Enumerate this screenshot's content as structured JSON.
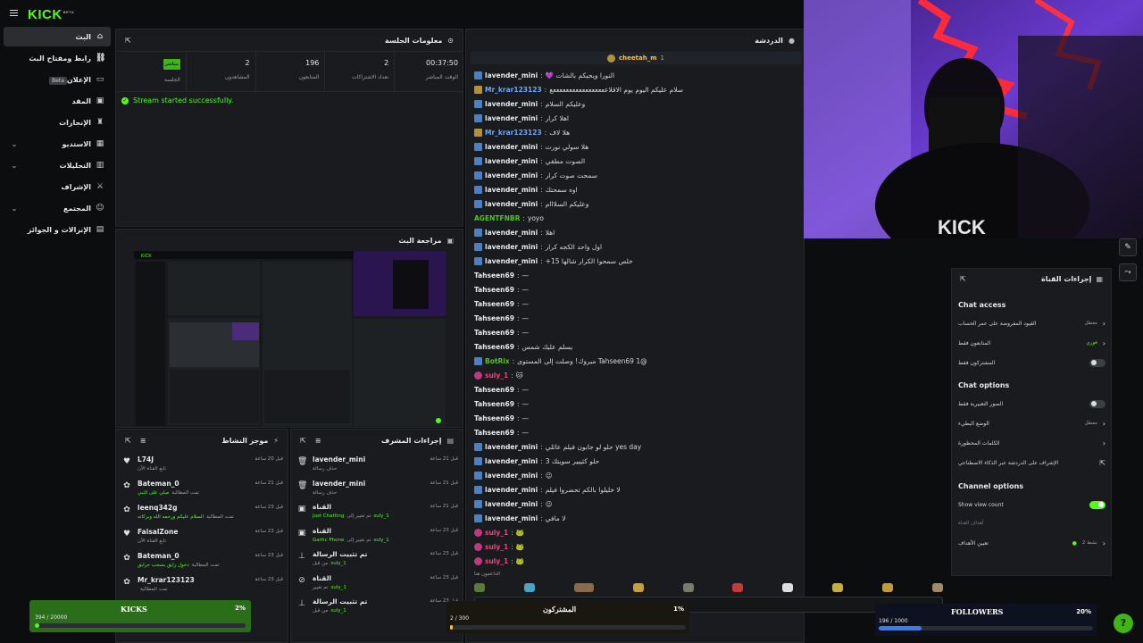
{
  "brand": {
    "logo": "KICK",
    "beta": "BETA"
  },
  "sidebar": {
    "items": [
      {
        "label": "البث",
        "icon": "home-icon",
        "active": true,
        "trail": ""
      },
      {
        "label": "رابط ومفتاح البث",
        "icon": "link-icon",
        "trail": ""
      },
      {
        "label": "الإعلان",
        "icon": "ad-icon",
        "badge": "Beta",
        "trail": ""
      },
      {
        "label": "المقد",
        "icon": "wallet-icon",
        "trail": ""
      },
      {
        "label": "الإنجازات",
        "icon": "trophy-icon",
        "trail": ""
      },
      {
        "label": "الاستديو",
        "icon": "studio-icon",
        "trail": "chevron"
      },
      {
        "label": "التحليلات",
        "icon": "analytics-icon",
        "trail": "chevron"
      },
      {
        "label": "الإشراف",
        "icon": "moderation-icon",
        "trail": ""
      },
      {
        "label": "المجتمع",
        "icon": "community-icon",
        "trail": "chevron"
      },
      {
        "label": "الإنزالات و الجوائز",
        "icon": "drops-icon",
        "trail": ""
      }
    ]
  },
  "session": {
    "title": "معلومات الجلسة",
    "live_label": "مباشر",
    "session_label": "الجلسة",
    "stats": [
      {
        "value": "2",
        "label": "المشاهدون"
      },
      {
        "value": "196",
        "label": "المتابعون"
      },
      {
        "value": "2",
        "label": "تعداد الاشتراكات"
      },
      {
        "value": "00:37:50",
        "label": "الوقت المباشر"
      }
    ],
    "message": "Stream started successfully."
  },
  "review": {
    "title": "مراجعة البث"
  },
  "chat": {
    "title": "الدردشة",
    "pinned_user": "cheetah_m",
    "pinned_count": "1",
    "messages": [
      {
        "user": "lavender_mini",
        "color": "#e6e8ea",
        "badge": "mod",
        "text": "النورا ويحيكم بالشات 💜"
      },
      {
        "user": "Mr_krar123123",
        "color": "#6aa7ff",
        "badge": "gold",
        "text": "سلام عليكم اليوم يوم الاقلاعععععععععععععععععع"
      },
      {
        "user": "lavender_mini",
        "color": "#e6e8ea",
        "badge": "mod",
        "text": "وعليكم السلام"
      },
      {
        "user": "lavender_mini",
        "color": "#e6e8ea",
        "badge": "mod",
        "text": "اهلا كرار"
      },
      {
        "user": "Mr_krar123123",
        "color": "#6aa7ff",
        "badge": "gold",
        "text": "هلا لاف"
      },
      {
        "user": "lavender_mini",
        "color": "#e6e8ea",
        "badge": "mod",
        "text": "هلا سولي نورت"
      },
      {
        "user": "lavender_mini",
        "color": "#e6e8ea",
        "badge": "mod",
        "text": "الصوت مطفي"
      },
      {
        "user": "lavender_mini",
        "color": "#e6e8ea",
        "badge": "mod",
        "text": "سمحت صوت كرار"
      },
      {
        "user": "lavender_mini",
        "color": "#e6e8ea",
        "badge": "mod",
        "text": "اوه سمحتك"
      },
      {
        "user": "lavender_mini",
        "color": "#e6e8ea",
        "badge": "mod",
        "text": "وعليكم السلااام"
      },
      {
        "user": "AGENTFNBR",
        "color": "#53c41a",
        "badge": "",
        "text": "yoyo"
      },
      {
        "user": "lavender_mini",
        "color": "#e6e8ea",
        "badge": "mod",
        "text": "اهلا"
      },
      {
        "user": "lavender_mini",
        "color": "#e6e8ea",
        "badge": "mod",
        "text": "اول واحد الكجه كرار"
      },
      {
        "user": "lavender_mini",
        "color": "#e6e8ea",
        "badge": "mod",
        "text": "خلص سمحوا الكرار شالها 15+"
      },
      {
        "user": "Tahseen69",
        "color": "#e6e8ea",
        "badge": "",
        "text": "—"
      },
      {
        "user": "Tahseen69",
        "color": "#e6e8ea",
        "badge": "",
        "text": "—"
      },
      {
        "user": "Tahseen69",
        "color": "#e6e8ea",
        "badge": "",
        "text": "—"
      },
      {
        "user": "Tahseen69",
        "color": "#e6e8ea",
        "badge": "",
        "text": "—"
      },
      {
        "user": "Tahseen69",
        "color": "#e6e8ea",
        "badge": "",
        "text": "—"
      },
      {
        "user": "Tahseen69",
        "color": "#e6e8ea",
        "badge": "",
        "text": "يسلم عليك شمس"
      },
      {
        "user": "BotRix",
        "color": "#53c41a",
        "badge": "mod",
        "text": "@Tahseen69 1 مبروك! وصلت إلى المستوى"
      },
      {
        "user": "suly_1",
        "color": "#e5487a",
        "badge": "pink",
        "text": "🐱"
      },
      {
        "user": "Tahseen69",
        "color": "#e6e8ea",
        "badge": "",
        "text": "—"
      },
      {
        "user": "Tahseen69",
        "color": "#e6e8ea",
        "badge": "",
        "text": "—"
      },
      {
        "user": "Tahseen69",
        "color": "#e6e8ea",
        "badge": "",
        "text": "—"
      },
      {
        "user": "Tahseen69",
        "color": "#e6e8ea",
        "badge": "",
        "text": "—"
      },
      {
        "user": "lavender_mini",
        "color": "#e6e8ea",
        "badge": "mod",
        "text": "yes day حلو لو جابون فيلم عائلي"
      },
      {
        "user": "lavender_mini",
        "color": "#e6e8ea",
        "badge": "mod",
        "text": "حلو كثييير سويتك 3"
      },
      {
        "user": "lavender_mini",
        "color": "#e6e8ea",
        "badge": "mod",
        "text": "😉"
      },
      {
        "user": "lavender_mini",
        "color": "#e6e8ea",
        "badge": "mod",
        "text": "لا خليلوا بالكم تحضروا فيلم"
      },
      {
        "user": "lavender_mini",
        "color": "#e6e8ea",
        "badge": "mod",
        "text": "😉"
      },
      {
        "user": "lavender_mini",
        "color": "#e6e8ea",
        "badge": "mod",
        "text": "لا مافي"
      },
      {
        "user": "suly_1",
        "color": "#e5487a",
        "badge": "pink",
        "text": "🐸"
      },
      {
        "user": "suly_1",
        "color": "#e5487a",
        "badge": "pink",
        "text": "🐸"
      },
      {
        "user": "suly_1",
        "color": "#e5487a",
        "badge": "pink",
        "text": "🐸"
      }
    ],
    "supporters_label": "الداعمون هنا"
  },
  "activity": {
    "title": "موجز النشاط",
    "items": [
      {
        "user": "L74J",
        "sub": "تابع القناة الآن",
        "time": "قبل 20 ساعة",
        "icon": "heart-icon"
      },
      {
        "user": "Bateman_0",
        "sub": "تمت المطالبة",
        "reward": "صلي على النبي",
        "time": "قبل 21 ساعة",
        "icon": "gift-icon"
      },
      {
        "user": "leenq342g",
        "sub": "تمت المطالبة",
        "reward": "السلام عليكم ورحمه الله وبركاته",
        "time": "قبل 23 ساعة",
        "icon": "gift-icon"
      },
      {
        "user": "FaisalZone",
        "sub": "تابع القناة الآن",
        "time": "قبل 23 ساعة",
        "icon": "heart-icon"
      },
      {
        "user": "Bateman_0",
        "sub": "تمت المطالبة",
        "reward": "دخول زايق بسحب حرايق",
        "time": "قبل 23 ساعة",
        "icon": "gift-icon"
      },
      {
        "user": "Mr_krar123123",
        "sub": "تمت المطالبة",
        "reward": "",
        "time": "قبل 23 ساعة",
        "icon": "gift-icon"
      }
    ]
  },
  "modactions": {
    "title": "إجراءات المشرف",
    "items": [
      {
        "user": "lavender_mini",
        "sub": "حذف رسالة",
        "time": "قبل 21 ساعة",
        "icon": "trash-icon"
      },
      {
        "user": "lavender_mini",
        "sub": "حذف رسالة",
        "time": "قبل 21 ساعة",
        "icon": "trash-icon"
      },
      {
        "user": "القناة",
        "sub": "تم تغيير إلى",
        "reward": "Just Chatting",
        "by": "suly_1",
        "time": "قبل 21 ساعة",
        "icon": "category-icon"
      },
      {
        "user": "القناة",
        "sub": "تم تغيير إلى",
        "reward": "Gartic Phone",
        "by": "suly_1",
        "time": "قبل 23 ساعة",
        "icon": "category-icon"
      },
      {
        "user": "تم تثبيت الرسالة",
        "sub": "من قبل",
        "by": "suly_1",
        "time": "قبل 23 ساعة",
        "icon": "pin-icon"
      },
      {
        "user": "القناة",
        "sub": "تم تغيير",
        "by": "suly_1",
        "time": "قبل 23 ساعة",
        "icon": "ban-icon"
      },
      {
        "user": "تم تثبيت الرسالة",
        "sub": "من قبل",
        "by": "suly_1",
        "time": "قبل 23 ساعة",
        "icon": "pin-icon"
      }
    ]
  },
  "channel_actions": {
    "title": "إجراءات القناة",
    "chat_access": "Chat access",
    "access_rows": [
      {
        "label": "القيود المفروضة على عمر الحساب",
        "value": "معطل",
        "type": "chev"
      },
      {
        "label": "المتابعون فقط",
        "value": "فوري",
        "type": "chev"
      },
      {
        "label": "المشتركون فقط",
        "value": "",
        "type": "toggle",
        "on": false
      }
    ],
    "chat_options": "Chat options",
    "option_rows": [
      {
        "label": "الصور التعبيرية فقط",
        "value": "",
        "type": "toggle",
        "on": false
      },
      {
        "label": "الوضع البطيء",
        "value": "معطل",
        "type": "chev"
      },
      {
        "label": "الكلمات المحظورة",
        "value": "",
        "type": "chev"
      },
      {
        "label": "الإشراف على الدردشة عبر الذكاء الاصطناعي",
        "value": "",
        "type": "ext"
      }
    ],
    "channel_options": "Channel options",
    "show_view_count": "Show view count",
    "channel_goals_label": "أهداف القناة",
    "set_goals": "تعيين الأهداف",
    "goals_active": "نشط 2"
  },
  "goals": {
    "kicks": {
      "title": "KICKS",
      "pct": "2%",
      "count": "394 / 20000",
      "fill": 0.02,
      "color": "#53fc18"
    },
    "subs": {
      "title": "المشتركون",
      "pct": "1%",
      "count": "2 / 300",
      "fill": 0.01,
      "color": "#f6c343"
    },
    "followers": {
      "title": "FOLLOWERS",
      "pct": "20%",
      "count": "196 / 1000",
      "fill": 0.2,
      "color": "#3b7bf0"
    }
  }
}
